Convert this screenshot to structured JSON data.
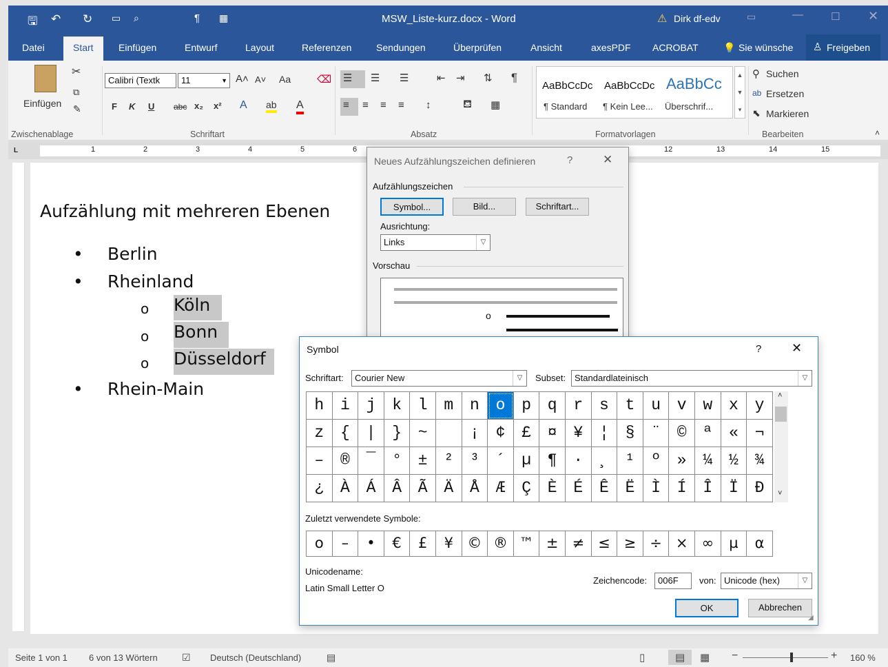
{
  "window": {
    "title": "MSW_Liste-kurz.docx  -  Word",
    "user": "Dirk df-edv",
    "warn_icon": "warning-icon"
  },
  "tabs": [
    "Datei",
    "Start",
    "Einfügen",
    "Entwurf",
    "Layout",
    "Referenzen",
    "Sendungen",
    "Überprüfen",
    "Ansicht",
    "axesPDF",
    "ACROBAT"
  ],
  "tellme": "Sie wünsche",
  "share": "Freigeben",
  "ribbon": {
    "paste": "Einfügen",
    "font_name": "Calibri (Textk",
    "font_size": "11",
    "aa": "Aa",
    "bold": "F",
    "italic": "K",
    "underline": "U",
    "strike": "abc",
    "sub": "x₂",
    "sup": "x²",
    "styles": [
      {
        "preview": "AaBbCcDc",
        "name": "¶ Standard"
      },
      {
        "preview": "AaBbCcDc",
        "name": "¶ Kein Lee..."
      },
      {
        "preview": "AaBbCc",
        "name": "Überschrif..."
      }
    ],
    "search": "Suchen",
    "replace": "Ersetzen",
    "select": "Markieren",
    "groups": [
      "Zwischenablage",
      "Schriftart",
      "Absatz",
      "Formatvorlagen",
      "Bearbeiten"
    ]
  },
  "ruler_numbers": [
    "1",
    "2",
    "3",
    "4",
    "5",
    "6",
    "12",
    "13",
    "14",
    "15"
  ],
  "document": {
    "heading": "Aufzählung mit mehreren Ebenen",
    "bullets": [
      "Berlin",
      "Rheinland",
      "Rhein-Main"
    ],
    "sub_bullets": [
      "Köln",
      "Bonn",
      "Düsseldorf"
    ],
    "bullet_char": "•",
    "sub_bullet_char": "o"
  },
  "status": {
    "page": "Seite 1 von 1",
    "words": "6 von 13 Wörtern",
    "lang": "Deutsch (Deutschland)",
    "zoom": "160 %"
  },
  "bullet_dialog": {
    "title": "Neues Aufzählungszeichen definieren",
    "help": "?",
    "section1": "Aufzählungszeichen",
    "symbol_btn": "Symbol...",
    "picture_btn": "Bild...",
    "font_btn": "Schriftart...",
    "align_label": "Ausrichtung:",
    "align_value": "Links",
    "preview_label": "Vorschau",
    "preview_bullet": "o"
  },
  "symbol_dialog": {
    "title": "Symbol",
    "help": "?",
    "font_label": "Schriftart:",
    "font_value": "Courier New",
    "subset_label": "Subset:",
    "subset_value": "Standardlateinisch",
    "grid": [
      [
        "h",
        "i",
        "j",
        "k",
        "l",
        "m",
        "n",
        "o",
        "p",
        "q",
        "r",
        "s",
        "t",
        "u",
        "v",
        "w",
        "x",
        "y"
      ],
      [
        "z",
        "{",
        "|",
        "}",
        "~",
        " ",
        "¡",
        "¢",
        "£",
        "¤",
        "¥",
        "¦",
        "§",
        "¨",
        "©",
        "ª",
        "«",
        "¬"
      ],
      [
        "–",
        "®",
        "¯",
        "°",
        "±",
        "²",
        "³",
        "´",
        "µ",
        "¶",
        "·",
        "¸",
        "¹",
        "º",
        "»",
        "¼",
        "½",
        "¾"
      ],
      [
        "¿",
        "À",
        "Á",
        "Â",
        "Ã",
        "Ä",
        "Å",
        "Æ",
        "Ç",
        "È",
        "É",
        "Ê",
        "Ë",
        "Ì",
        "Í",
        "Î",
        "Ï",
        "Ð"
      ]
    ],
    "selected_row": 0,
    "selected_col": 7,
    "recent_label": "Zuletzt verwendete Symbole:",
    "recent": [
      "o",
      "–",
      "•",
      "€",
      "£",
      "¥",
      "©",
      "®",
      "™",
      "±",
      "≠",
      "≤",
      "≥",
      "÷",
      "×",
      "∞",
      "µ",
      "α"
    ],
    "unicode_name_label": "Unicodename:",
    "unicode_name": "Latin Small Letter O",
    "charcode_label": "Zeichencode:",
    "charcode_value": "006F",
    "from_label": "von:",
    "from_value": "Unicode (hex)",
    "ok": "OK",
    "cancel": "Abbrechen"
  }
}
